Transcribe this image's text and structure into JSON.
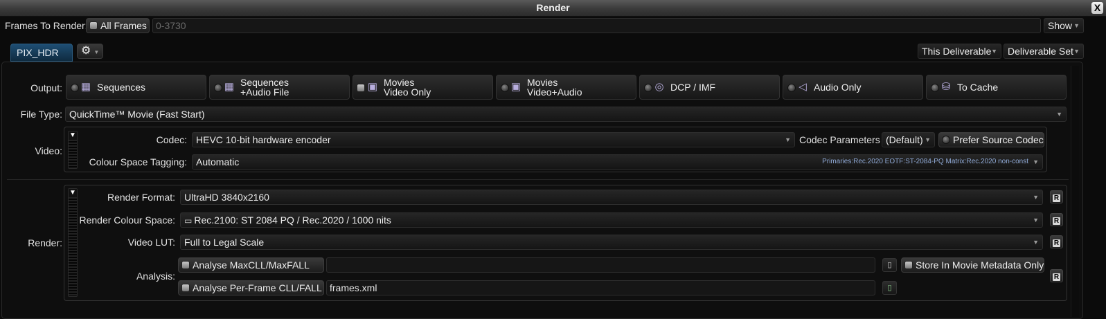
{
  "window": {
    "title": "Render",
    "close_label": "X"
  },
  "frames": {
    "label": "Frames To Render:",
    "all_frames_label": "All Frames",
    "range_placeholder": "0-3730",
    "show_label": "Show"
  },
  "tab": {
    "label": "PIX_HDR"
  },
  "deliverable": {
    "this_label": "This Deliverable",
    "set_label": "Deliverable Set"
  },
  "output": {
    "label": "Output:",
    "options": [
      {
        "line1": "Sequences",
        "line2": "",
        "icon": "film-strip-icon"
      },
      {
        "line1": "Sequences",
        "line2": "+Audio File",
        "icon": "film-audio-icon"
      },
      {
        "line1": "Movies",
        "line2": "Video Only",
        "icon": "movie-icon"
      },
      {
        "line1": "Movies",
        "line2": "Video+Audio",
        "icon": "movie-audio-icon"
      },
      {
        "line1": "DCP / IMF",
        "line2": "",
        "icon": "target-icon"
      },
      {
        "line1": "Audio Only",
        "line2": "",
        "icon": "speaker-icon"
      },
      {
        "line1": "To Cache",
        "line2": "",
        "icon": "cache-icon"
      }
    ],
    "selected": "Movies Video Only"
  },
  "file_type": {
    "label": "File Type:",
    "value": "QuickTime™ Movie (Fast Start)"
  },
  "video": {
    "label": "Video:",
    "codec_label": "Codec:",
    "codec_value": "HEVC 10-bit hardware encoder",
    "codec_params_label": "Codec Parameters",
    "codec_params_value": "(Default)",
    "prefer_source_label": "Prefer Source Codec",
    "colour_tagging_label": "Colour Space Tagging:",
    "colour_tagging_value": "Automatic",
    "colour_tagging_details": "Primaries:Rec.2020  EOTF:ST-2084-PQ  Matrix:Rec.2020 non-const"
  },
  "render": {
    "label": "Render:",
    "format_label": "Render Format:",
    "format_value": "UltraHD 3840x2160",
    "colour_space_label": "Render Colour Space:",
    "colour_space_value": "Rec.2100: ST 2084 PQ / Rec.2020 / 1000 nits",
    "video_lut_label": "Video LUT:",
    "video_lut_value": "Full to Legal Scale",
    "analysis_label": "Analysis:",
    "analyse_maxcll_label": "Analyse MaxCLL/MaxFALL",
    "maxcll_path": "",
    "store_metadata_label": "Store In Movie Metadata Only",
    "analyse_perframe_label": "Analyse Per-Frame CLL/FALL",
    "perframe_file": "frames.xml",
    "r_button_label": "R"
  },
  "colors": {
    "accent_tab": "#1e4e73",
    "tag_text": "#8fa9d6",
    "icon_purple": "#b8aede"
  }
}
